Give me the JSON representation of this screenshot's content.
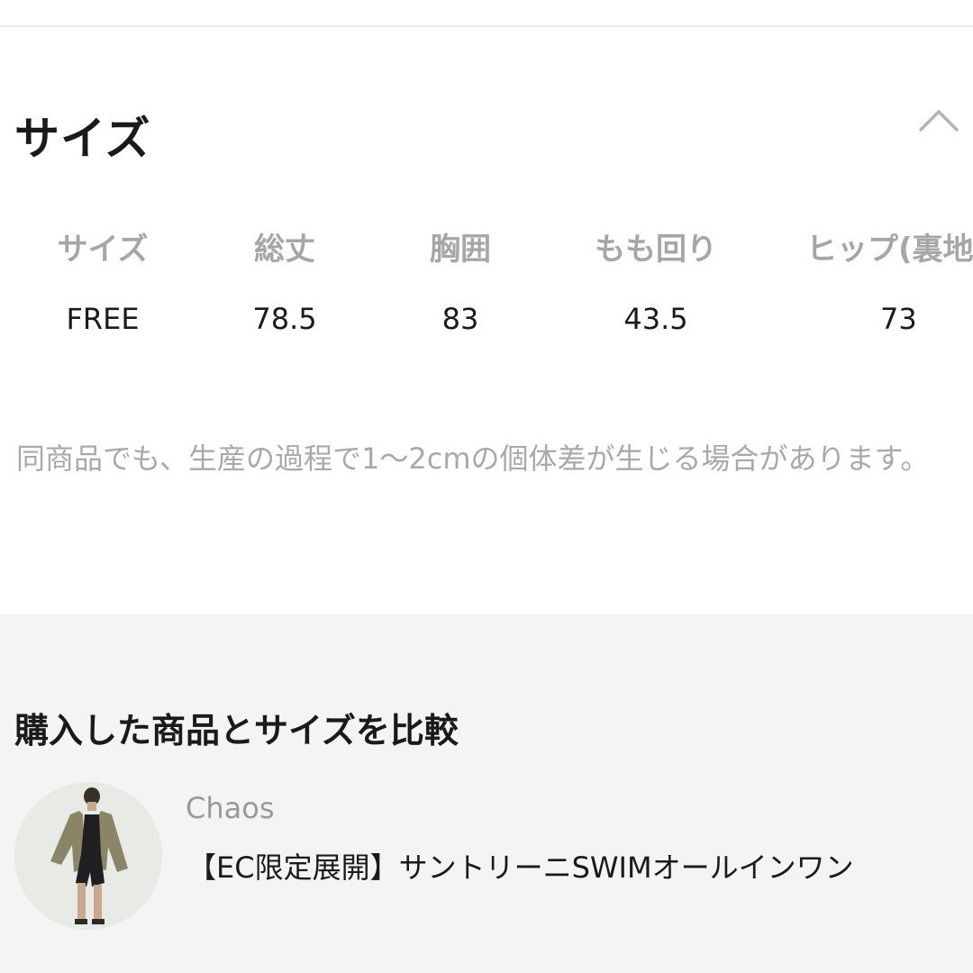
{
  "size_section": {
    "title": "サイズ",
    "toggle_icon": "chevron-up-icon",
    "table": {
      "headers": [
        "サイズ",
        "総丈",
        "胸囲",
        "もも回り",
        "ヒップ(裏地"
      ],
      "rows": [
        [
          "FREE",
          "78.5",
          "83",
          "43.5",
          "73"
        ]
      ]
    },
    "note": "同商品でも、生産の過程で1〜2cmの個体差が生じる場合があります。"
  },
  "compare_section": {
    "title": "購入した商品とサイズを比較",
    "products": [
      {
        "brand": "Chaos",
        "name": "【EC限定展開】サントリーニSWIMオールインワン",
        "thumbnail_icon": "product-photo"
      }
    ]
  },
  "colors": {
    "text_primary": "#1a1a1a",
    "text_muted": "#a6a6a6",
    "compare_background": "#f4f4f4",
    "divider": "#ececec"
  }
}
